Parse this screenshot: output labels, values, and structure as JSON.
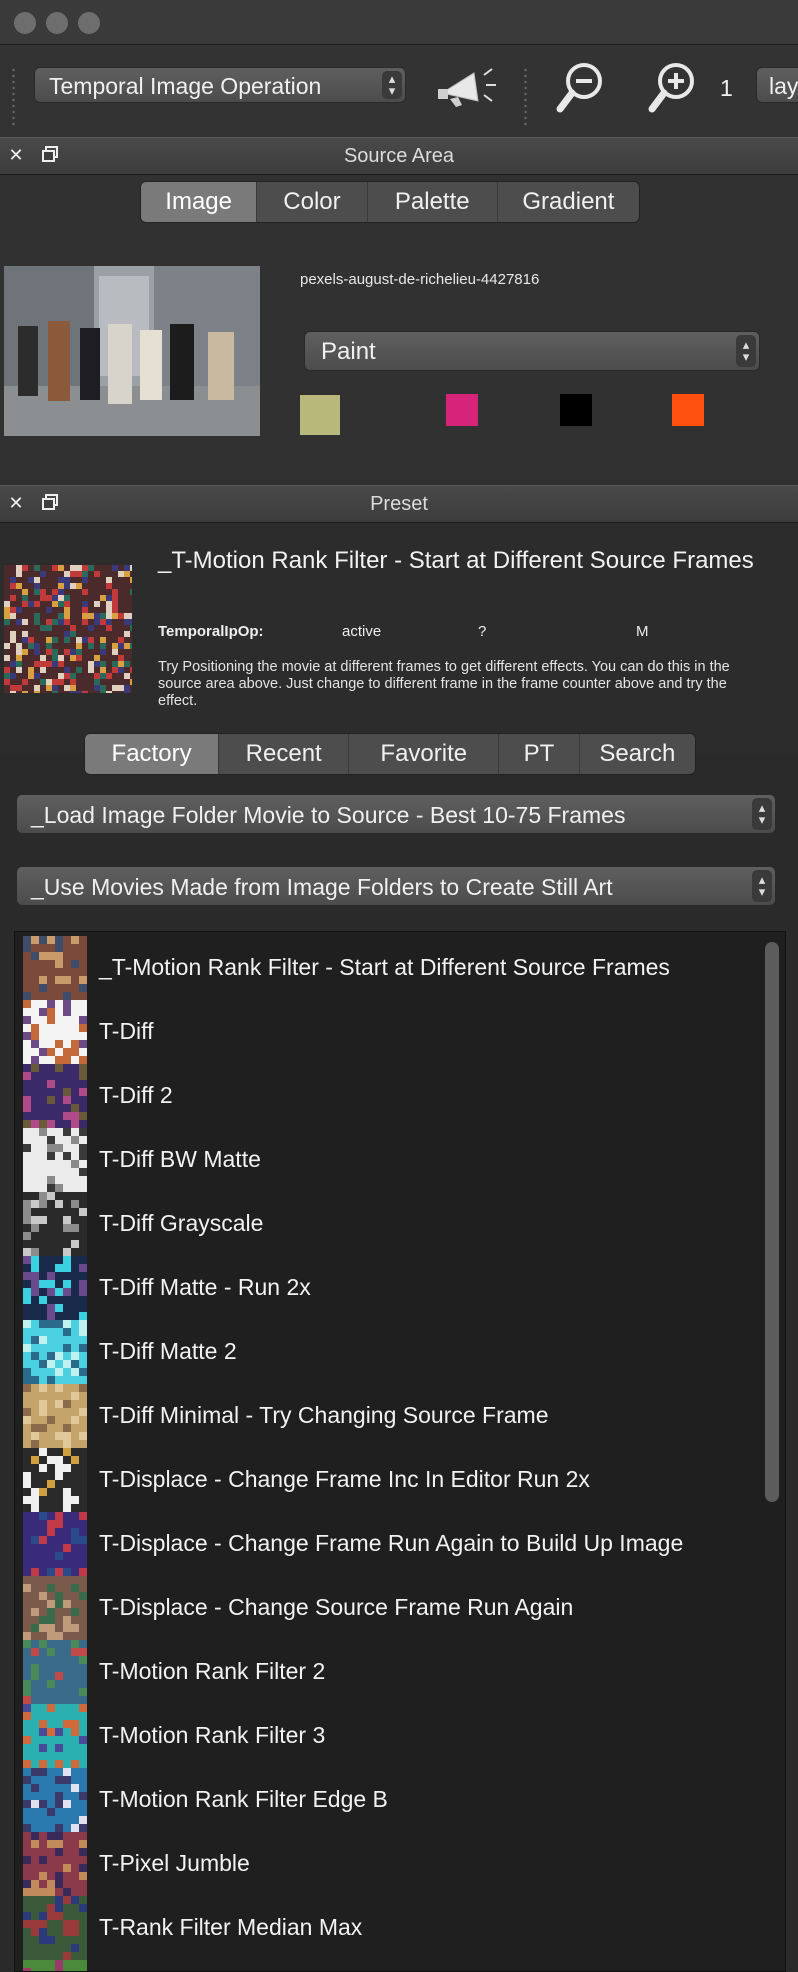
{
  "toolbar": {
    "operation_select": "Temporal Image Operation",
    "frame_value": "1",
    "layer_select": "lay"
  },
  "source_panel": {
    "title": "Source Area",
    "tabs": [
      "Image",
      "Color",
      "Palette",
      "Gradient"
    ],
    "selected_tab": "Image",
    "file_name": "pexels-august-de-richelieu-4427816",
    "mode_select": "Paint",
    "swatches": [
      "#b8b87a",
      "#d6247a",
      "#000000",
      "#ff5010"
    ]
  },
  "preset_panel": {
    "title": "Preset",
    "name": "_T-Motion Rank Filter - Start at Different Source Frames",
    "type_label": "TemporalIpOp:",
    "status": "active",
    "question": "?",
    "flag": "M",
    "description": "Try Positioning the movie at different frames to get different effects.  You can do this in the source area above.  Just change to different frame in the frame counter above and try the effect.",
    "tabs": [
      "Factory",
      "Recent",
      "Favorite",
      "PT",
      "Search"
    ],
    "selected_tab": "Factory",
    "category_select": "_Load Image Folder Movie to Source - Best 10-75 Frames",
    "subcategory_select": "_Use Movies Made from Image Folders to Create Still Art",
    "items": [
      {
        "label": "_T-Motion Rank Filter - Start at Different Source Frames",
        "colors": [
          "#7b4a3a",
          "#c99a6a",
          "#3e4d6a"
        ]
      },
      {
        "label": "T-Diff",
        "colors": [
          "#f4f4f4",
          "#6b4a86",
          "#c46a3a"
        ]
      },
      {
        "label": "T-Diff 2",
        "colors": [
          "#3a2a6a",
          "#b04a8a",
          "#6a5a3a"
        ]
      },
      {
        "label": "T-Diff BW Matte",
        "colors": [
          "#ececec",
          "#8a8a8a",
          "#3a3a3a"
        ]
      },
      {
        "label": "T-Diff Grayscale",
        "colors": [
          "#2a2a2a",
          "#8c8c8c",
          "#c8c8c8"
        ]
      },
      {
        "label": "T-Diff Matte - Run 2x",
        "colors": [
          "#1a2a4a",
          "#3ad0e0",
          "#6a4a8a"
        ]
      },
      {
        "label": "T-Diff Matte 2",
        "colors": [
          "#4ad0e0",
          "#2a6a8a",
          "#c0f0f0"
        ]
      },
      {
        "label": "T-Diff Minimal - Try Changing Source Frame",
        "colors": [
          "#c4a46a",
          "#8a6a4a",
          "#e0c89a"
        ]
      },
      {
        "label": "T-Displace - Change Frame Inc In Editor Run 2x",
        "colors": [
          "#2a2a2a",
          "#d0a040",
          "#f0f0f0"
        ]
      },
      {
        "label": "T-Displace - Change Frame Run Again to Build Up Image",
        "colors": [
          "#3a2a7a",
          "#c03a4a",
          "#2a4a8a"
        ]
      },
      {
        "label": "T-Displace - Change Source Frame Run Again",
        "colors": [
          "#7a5a4a",
          "#3a6a4a",
          "#c09a7a"
        ]
      },
      {
        "label": "T-Motion Rank Filter 2",
        "colors": [
          "#3a6a8a",
          "#c04a4a",
          "#4a8a5a"
        ]
      },
      {
        "label": "T-Motion Rank Filter 3",
        "colors": [
          "#2ab0b0",
          "#4a4a9a",
          "#d06a3a"
        ]
      },
      {
        "label": "T-Motion Rank Filter Edge B",
        "colors": [
          "#2a7ab0",
          "#e0e0f0",
          "#3a3a6a"
        ]
      },
      {
        "label": "T-Pixel Jumble",
        "colors": [
          "#8a3a4a",
          "#3a2a5a",
          "#c08a5a"
        ]
      },
      {
        "label": "T-Rank Filter Median Max",
        "colors": [
          "#3a5a3a",
          "#9a3a3a",
          "#2a3a7a"
        ]
      },
      {
        "label": "",
        "colors": [
          "#4a8a3a",
          "#9a3a6a",
          "#3a6a9a"
        ]
      }
    ]
  }
}
